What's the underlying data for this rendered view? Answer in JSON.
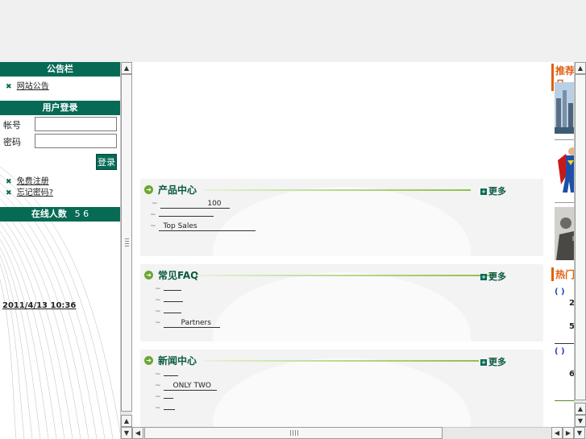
{
  "left": {
    "announcement_header": "公告栏",
    "announcement_link": "网站公告",
    "login_header": "用户登录",
    "username_label": "帐号",
    "password_label": "密码",
    "login_button": "登录",
    "register_link": "免费注册",
    "forgot_link": "忘记密码?",
    "online_header": "在线人数",
    "online_count": "5 6",
    "datetime": "2011/4/13 10:36"
  },
  "main": {
    "panels": [
      {
        "title": "产品中心",
        "more": "更多",
        "items": [
          "100",
          "",
          "Top Sales"
        ]
      },
      {
        "title": "常见FAQ",
        "more": "更多",
        "items": [
          "",
          "",
          "",
          "Partners"
        ]
      },
      {
        "title": "新闻中心",
        "more": "更多",
        "items": [
          "",
          "ONLY TWO",
          "",
          ""
        ]
      }
    ]
  },
  "right": {
    "header1": "推荐产品",
    "header2": "热门",
    "snippets": [
      "( )",
      "2",
      "5",
      "( )",
      "6"
    ]
  },
  "icons": [
    "bullet-x-icon",
    "arrow-circle-icon",
    "plus-icon",
    "scroll-up-icon",
    "scroll-down-icon",
    "scroll-left-icon",
    "scroll-right-icon"
  ],
  "colors": {
    "brand_green": "#066a55",
    "accent_orange": "#e06010",
    "accent_lime": "#8fc04a"
  }
}
